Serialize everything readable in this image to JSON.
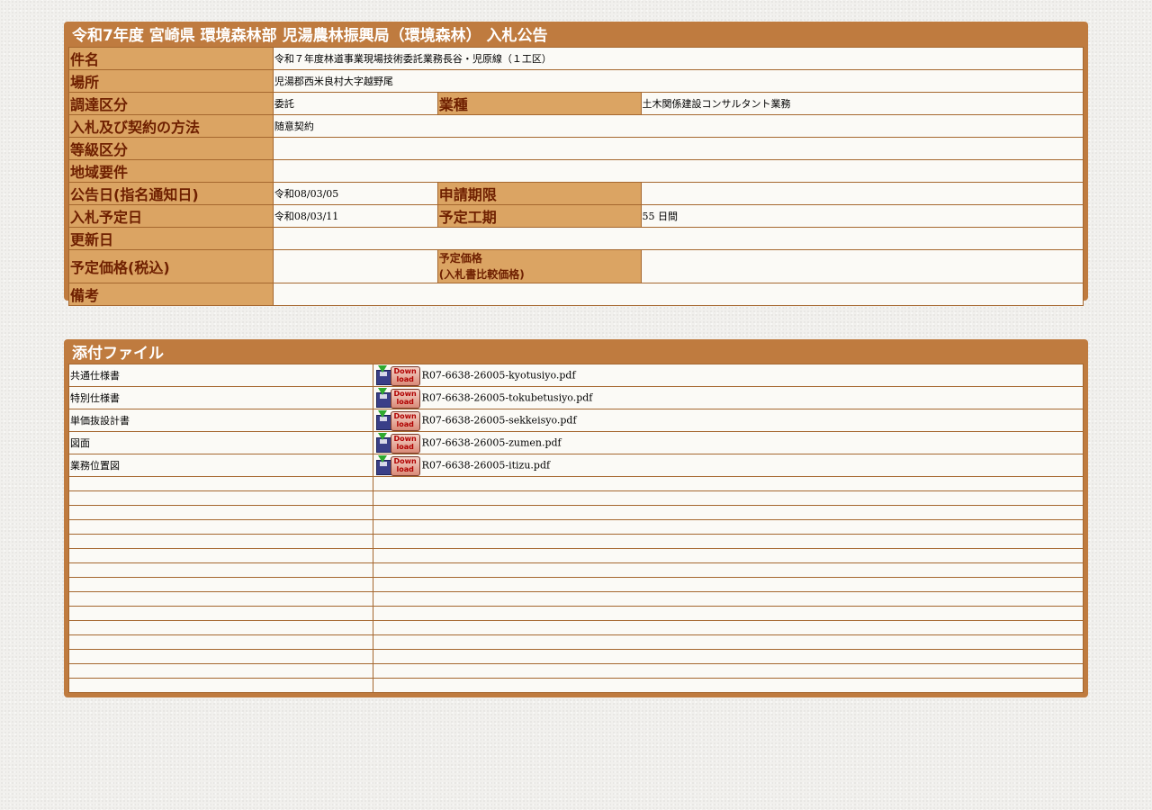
{
  "notice": {
    "title": "令和7年度 宮崎県 環境森林部 児湯農林振興局（環境森林） 入札公告",
    "labels": {
      "kenmei": "件名",
      "basho": "場所",
      "chotatsu": "調達区分",
      "gyoshu": "業種",
      "hoho": "入札及び契約の方法",
      "tokyu": "等級区分",
      "chiiki": "地域要件",
      "kokokubi": "公告日(指名通知日)",
      "shinsei": "申請期限",
      "yoteibi": "入札予定日",
      "koki": "予定工期",
      "koshinbi": "更新日",
      "yoteikakaku": "予定価格(税込)",
      "yoteikakaku2_line1": "予定価格",
      "yoteikakaku2_line2": "(入札書比較価格)",
      "biko": "備考"
    },
    "values": {
      "kenmei": "令和７年度林道事業現場技術委託業務長谷・児原線（１工区）",
      "basho": "児湯郡西米良村大字越野尾",
      "chotatsu": "委託",
      "gyoshu": "土木関係建設コンサルタント業務",
      "hoho": "随意契約",
      "tokyu": "",
      "chiiki": "",
      "kokokubi": "令和08/03/05",
      "shinsei": "",
      "yoteibi": "令和08/03/11",
      "koki": "55 日間",
      "koshinbi": "",
      "yoteikakaku": "",
      "yoteikakaku2": "",
      "biko": ""
    }
  },
  "attachments": {
    "title": "添付ファイル",
    "download_icon_text": "Down load",
    "files": [
      {
        "label": "共通仕様書",
        "filename": "R07-6638-26005-kyotusiyo.pdf"
      },
      {
        "label": "特別仕様書",
        "filename": "R07-6638-26005-tokubetusiyo.pdf"
      },
      {
        "label": "単価抜設計書",
        "filename": "R07-6638-26005-sekkeisyo.pdf"
      },
      {
        "label": "図面",
        "filename": "R07-6638-26005-zumen.pdf"
      },
      {
        "label": "業務位置図",
        "filename": "R07-6638-26005-itizu.pdf"
      }
    ],
    "empty_rows": 15
  },
  "colors": {
    "frame": "#bf7b3f",
    "label_bg": "#dba463",
    "label_text": "#6e1f00",
    "value_bg": "#fbfaf6"
  }
}
